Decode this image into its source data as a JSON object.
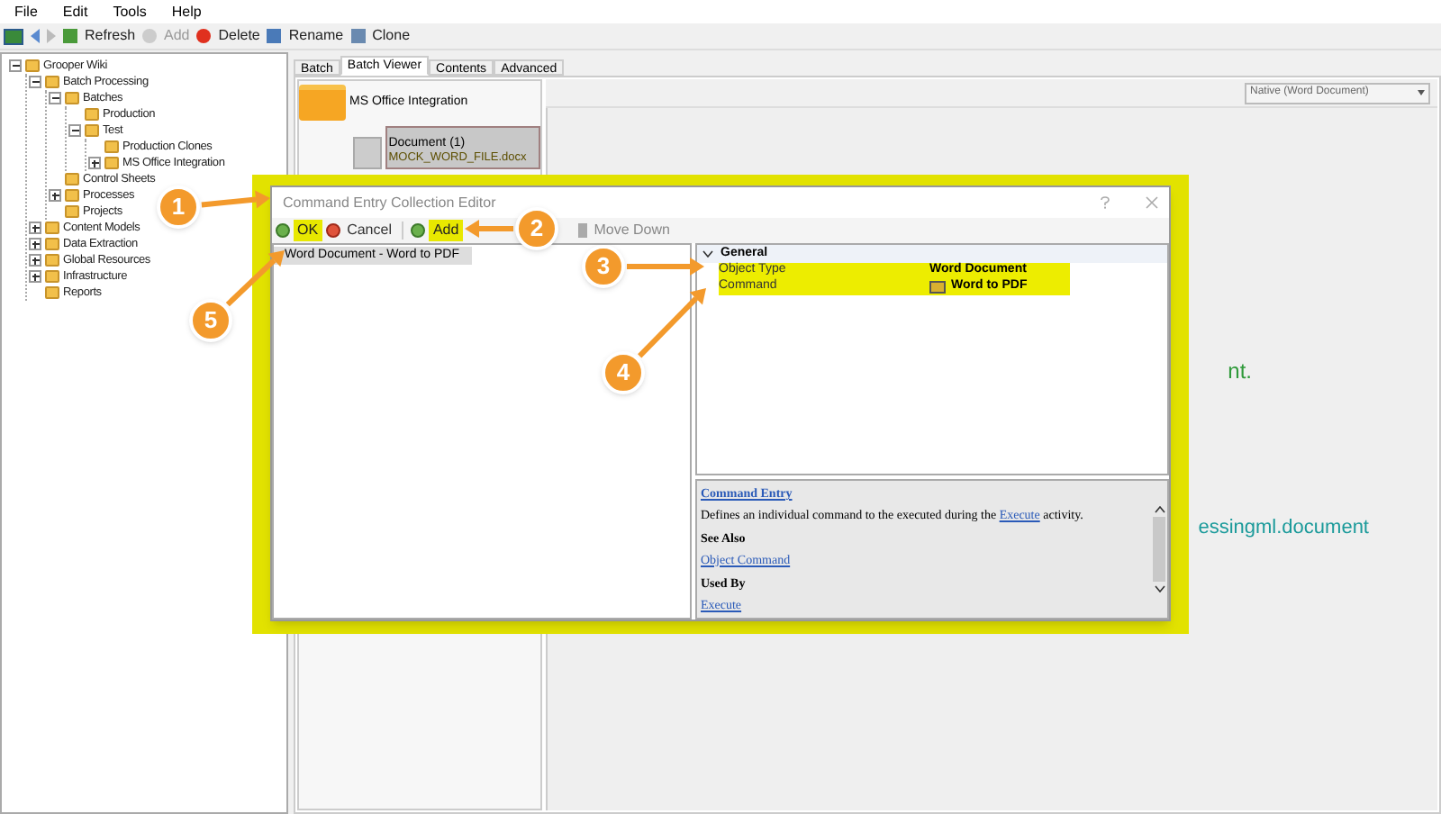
{
  "menu": [
    "File",
    "Edit",
    "Tools",
    "Help"
  ],
  "toolbar": [
    {
      "label": "Refresh",
      "disabled": false
    },
    {
      "label": "Add",
      "disabled": true
    },
    {
      "label": "Delete",
      "disabled": false
    },
    {
      "label": "Rename",
      "disabled": false
    },
    {
      "label": "Clone",
      "disabled": false
    }
  ],
  "tree": [
    {
      "label": "Grooper Wiki",
      "expanded": true,
      "children": [
        {
          "label": "Batch Processing",
          "expanded": true,
          "children": [
            {
              "label": "Batches",
              "expanded": true,
              "children": [
                {
                  "label": "Production"
                },
                {
                  "label": "Test",
                  "expanded": true,
                  "children": [
                    {
                      "label": "Production Clones"
                    },
                    {
                      "label": "MS Office Integration",
                      "expanded": false
                    }
                  ]
                }
              ]
            },
            {
              "label": "Control Sheets"
            },
            {
              "label": "Processes",
              "expanded": false
            },
            {
              "label": "Projects"
            }
          ]
        },
        {
          "label": "Content Models",
          "expanded": false
        },
        {
          "label": "Data Extraction",
          "expanded": false
        },
        {
          "label": "Global Resources",
          "expanded": false
        },
        {
          "label": "Infrastructure",
          "expanded": false
        },
        {
          "label": "Reports"
        }
      ]
    }
  ],
  "tabs": [
    {
      "label": "Batch",
      "selected": false
    },
    {
      "label": "Batch Viewer",
      "selected": true
    },
    {
      "label": "Contents",
      "selected": false
    },
    {
      "label": "Advanced",
      "selected": false
    }
  ],
  "batch_viewer": {
    "folder": "MS Office Integration",
    "document": "Document (1)",
    "file": "MOCK_WORD_FILE.docx",
    "view_mode": "Native (Word Document)",
    "preview_lines": [
      "nt.",
      "essingml.document"
    ]
  },
  "dialog": {
    "title": "Command Entry Collection Editor",
    "buttons": [
      {
        "label": "OK",
        "highlighted": true
      },
      {
        "label": "Cancel",
        "highlighted": false
      },
      {
        "label": "Add",
        "highlighted": true
      },
      {
        "label": "Move Down",
        "highlighted": false
      }
    ],
    "entries": [
      {
        "label": "Word Document - Word to PDF",
        "selected": true
      }
    ],
    "category": "General",
    "properties": [
      {
        "name": "Object Type",
        "value": "Word Document",
        "highlighted": true
      },
      {
        "name": "Command",
        "value": "Word to PDF",
        "highlighted": true
      }
    ],
    "help": {
      "title": "Command Entry",
      "description_before": "Defines an individual command to the executed during the",
      "description_link": "Execute",
      "description_after": "activity.",
      "see_also_heading": "See Also",
      "see_also_link": "Object Command",
      "used_by_heading": "Used By",
      "used_by_link": "Execute"
    }
  },
  "callouts": [
    {
      "number": "1"
    },
    {
      "number": "2"
    },
    {
      "number": "3"
    },
    {
      "number": "4"
    },
    {
      "number": "5"
    }
  ]
}
